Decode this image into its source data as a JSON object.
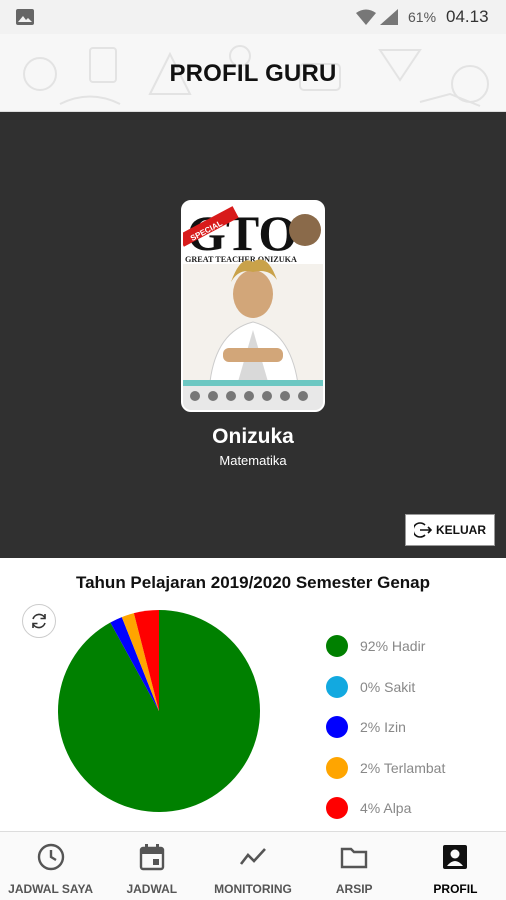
{
  "status_bar": {
    "battery_percent": "61%",
    "time": "04.13",
    "icons": [
      "gallery-icon",
      "wifi-icon",
      "signal-icon"
    ]
  },
  "header": {
    "title": "PROFIL GURU"
  },
  "profile": {
    "name": "Onizuka",
    "subject": "Matematika",
    "logout_label": "KELUAR",
    "avatar_text": {
      "banner": "SPECIAL",
      "big": "GTO",
      "subtitle": "GREAT TEACHER ONIZUKA"
    }
  },
  "stats": {
    "title": "Tahun Pelajaran 2019/2020 Semester Genap"
  },
  "chart_data": {
    "type": "pie",
    "slices": [
      {
        "label": "92% Hadir",
        "value": 92,
        "color": "#008000"
      },
      {
        "label": "0% Sakit",
        "value": 0,
        "color": "#12a9e0"
      },
      {
        "label": "2% Izin",
        "value": 2,
        "color": "#0000ff"
      },
      {
        "label": "2% Terlambat",
        "value": 2,
        "color": "#ffa500"
      },
      {
        "label": "4% Alpa",
        "value": 4,
        "color": "#ff0000"
      }
    ],
    "legend_position": "right"
  },
  "nav": {
    "items": [
      {
        "label": "JADWAL SAYA",
        "icon": "clock-icon",
        "active": false
      },
      {
        "label": "JADWAL",
        "icon": "calendar-icon",
        "active": false
      },
      {
        "label": "MONITORING",
        "icon": "chart-line-icon",
        "active": false
      },
      {
        "label": "ARSIP",
        "icon": "folder-icon",
        "active": false
      },
      {
        "label": "PROFIL",
        "icon": "profile-icon",
        "active": true
      }
    ]
  }
}
